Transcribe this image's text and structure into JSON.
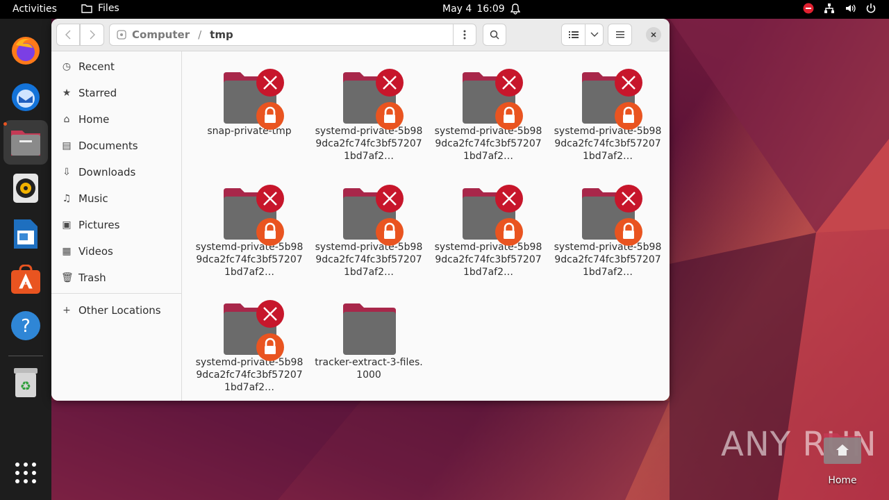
{
  "topbar": {
    "activities": "Activities",
    "app_name": "Files",
    "date": "May 4",
    "time": "16:09"
  },
  "dock": {
    "items": [
      "Firefox",
      "Thunderbird",
      "Files",
      "Rhythmbox",
      "LibreOffice Writer",
      "Ubuntu Software",
      "Help",
      "Trash"
    ]
  },
  "window": {
    "path": {
      "root": "Computer",
      "separator": "/",
      "current": "tmp"
    }
  },
  "sidebar": {
    "items": [
      {
        "label": "Recent",
        "icon": "clock-icon"
      },
      {
        "label": "Starred",
        "icon": "star-icon"
      },
      {
        "label": "Home",
        "icon": "home-icon"
      },
      {
        "label": "Documents",
        "icon": "document-icon"
      },
      {
        "label": "Downloads",
        "icon": "download-icon"
      },
      {
        "label": "Music",
        "icon": "music-icon"
      },
      {
        "label": "Pictures",
        "icon": "picture-icon"
      },
      {
        "label": "Videos",
        "icon": "video-icon"
      },
      {
        "label": "Trash",
        "icon": "trash-icon"
      }
    ],
    "other_locations": "Other Locations"
  },
  "files": [
    {
      "name": "snap-private-tmp",
      "locked": true
    },
    {
      "name": "systemd-private-5b989dca2fc74fc3bf572071bd7af2…",
      "locked": true
    },
    {
      "name": "systemd-private-5b989dca2fc74fc3bf572071bd7af2…",
      "locked": true
    },
    {
      "name": "systemd-private-5b989dca2fc74fc3bf572071bd7af2…",
      "locked": true
    },
    {
      "name": "systemd-private-5b989dca2fc74fc3bf572071bd7af2…",
      "locked": true
    },
    {
      "name": "systemd-private-5b989dca2fc74fc3bf572071bd7af2…",
      "locked": true
    },
    {
      "name": "systemd-private-5b989dca2fc74fc3bf572071bd7af2…",
      "locked": true
    },
    {
      "name": "systemd-private-5b989dca2fc74fc3bf572071bd7af2…",
      "locked": true
    },
    {
      "name": "systemd-private-5b989dca2fc74fc3bf572071bd7af2…",
      "locked": true
    },
    {
      "name": "tracker-extract-3-files.1000",
      "locked": false
    }
  ],
  "desktop": {
    "home_label": "Home",
    "watermark": "ANY RUN"
  },
  "colors": {
    "accent": "#e95420",
    "emblem_red": "#c7162b",
    "folder_gray": "#6b6b6b",
    "folder_tab": "#a8274a"
  }
}
